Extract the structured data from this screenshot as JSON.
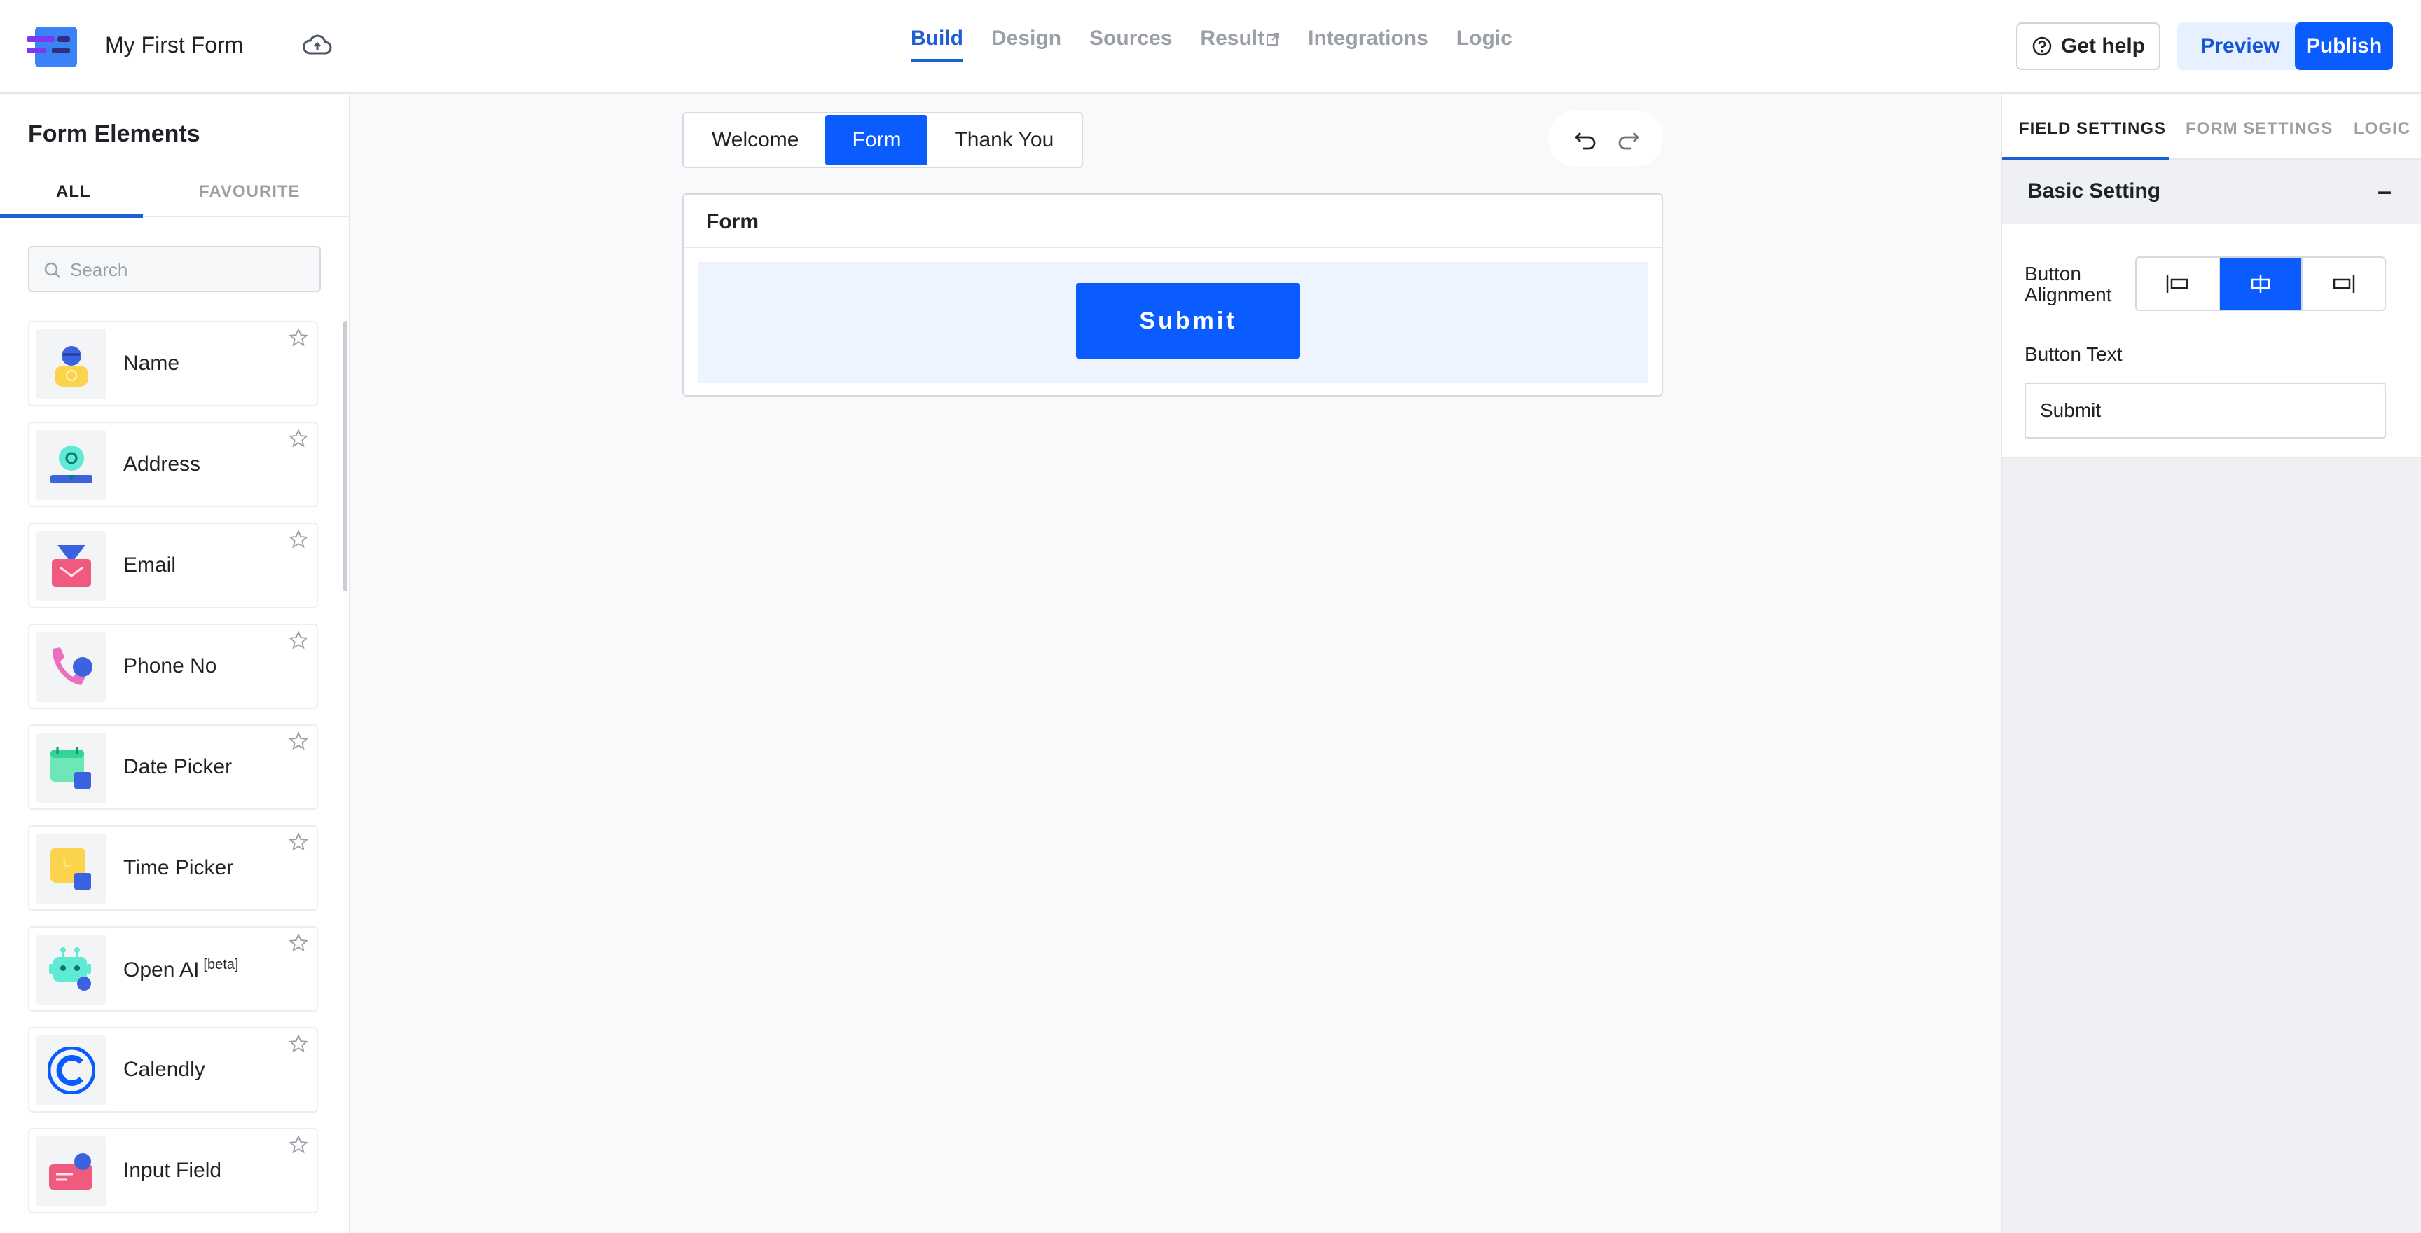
{
  "header": {
    "title": "My First Form",
    "nav": [
      "Build",
      "Design",
      "Sources",
      "Result",
      "Integrations",
      "Logic"
    ],
    "active_nav": "Build",
    "help_label": "Get help",
    "preview_label": "Preview",
    "publish_label": "Publish"
  },
  "sidebar": {
    "title": "Form Elements",
    "tabs": {
      "all": "ALL",
      "favourite": "FAVOURITE"
    },
    "search_placeholder": "Search",
    "elements": [
      {
        "label": "Name",
        "icon": "name-icon"
      },
      {
        "label": "Address",
        "icon": "address-icon"
      },
      {
        "label": "Email",
        "icon": "email-icon"
      },
      {
        "label": "Phone No",
        "icon": "phone-icon"
      },
      {
        "label": "Date Picker",
        "icon": "date-picker-icon"
      },
      {
        "label": "Time Picker",
        "icon": "time-picker-icon"
      },
      {
        "label": "Open AI",
        "badge": "[beta]",
        "icon": "open-ai-icon"
      },
      {
        "label": "Calendly",
        "icon": "calendly-icon"
      },
      {
        "label": "Input Field",
        "icon": "input-field-icon"
      }
    ]
  },
  "canvas": {
    "tabs": [
      "Welcome",
      "Form",
      "Thank You"
    ],
    "active_tab": "Form",
    "form_title": "Form",
    "submit_label": "Submit"
  },
  "right_panel": {
    "tabs": {
      "field": "FIELD SETTINGS",
      "form": "FORM SETTINGS",
      "logic": "LOGIC"
    },
    "section_title": "Basic Setting",
    "collapse_symbol": "–",
    "alignment_label": "Button Alignment",
    "alignment_active": "center",
    "button_text_label": "Button Text",
    "button_text_value": "Submit"
  },
  "colors": {
    "primary": "#0b5cff",
    "accent": "#1f5fd6",
    "preview_bg": "#e6f0ff"
  }
}
